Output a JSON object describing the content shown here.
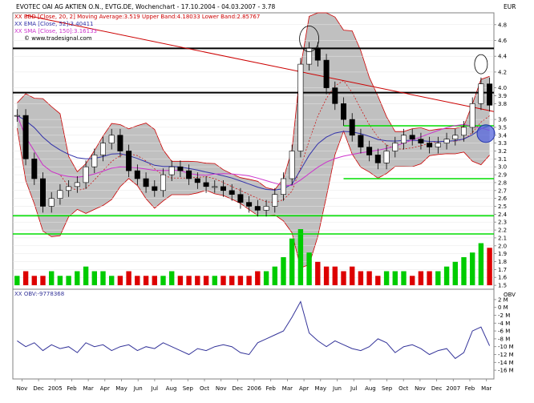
{
  "header": {
    "title_line": "EVOTEC OAI AG AKTIEN O.N., EVTG.DE, Wochenchart - 17.10.2004 - 04.03.2007 - 3.78",
    "legend": [
      {
        "text": "BBD [Close, 20, 2] Moving Average:3.519 Upper Band:4.18033 Lower Band:2.85767",
        "color": "#cc0000"
      },
      {
        "text": "EMA [Close, 52]:3.40411",
        "color": "#3333aa"
      },
      {
        "text": "SMA [Close, 150]:3.16133",
        "color": "#cc33cc"
      },
      {
        "text": "© www.tradesignal.com",
        "color": "#000000"
      }
    ],
    "currency_label": "EUR"
  },
  "indicator_label": "OBV:-9778368",
  "indicator_axis_title": "OBV",
  "colors": {
    "band_fill": "#c0c0c0",
    "band_line": "#cc0000",
    "ema": "#3333aa",
    "sma": "#cc33cc",
    "up_volume": "#00cc00",
    "down_volume": "#dd0000",
    "support_line": "#00dd00",
    "resistance_line": "#000000",
    "trend_line": "#cc0000",
    "obv_line": "#333399",
    "highlight_circle": "#5566dd"
  },
  "chart_data": [
    {
      "type": "candlestick",
      "title": "EVOTEC OAI AG AKTIEN O.N., EVTG.DE, Wochenchart - 17.10.2004 - 04.03.2007 - 3.78",
      "ylabel": "EUR",
      "ylim": [
        1.45,
        4.95
      ],
      "y_ticks": [
        1.5,
        1.6,
        1.7,
        1.8,
        1.9,
        2.0,
        2.1,
        2.2,
        2.3,
        2.4,
        2.5,
        2.6,
        2.7,
        2.8,
        2.9,
        3.0,
        3.1,
        3.2,
        3.3,
        3.4,
        3.5,
        3.6,
        3.8,
        3.9,
        4.0,
        4.2,
        4.4,
        4.6,
        4.8
      ],
      "x_tick_labels": [
        "Nov",
        "Dec",
        "2005",
        "Feb",
        "Mar",
        "Apr",
        "May",
        "Jun",
        "Jul",
        "Aug",
        "Sep",
        "Oct",
        "Nov",
        "Dec",
        "2006",
        "Feb",
        "Mar",
        "Apr",
        "May",
        "Jun",
        "Jul",
        "Aug",
        "Sep",
        "Oct",
        "Nov",
        "Dec",
        "2007",
        "Feb",
        "Mar"
      ],
      "close_series": [
        3.65,
        3.1,
        2.85,
        2.5,
        2.6,
        2.7,
        2.75,
        2.8,
        3.0,
        3.15,
        3.3,
        3.4,
        3.2,
        2.95,
        2.85,
        2.75,
        2.7,
        2.9,
        3.0,
        2.95,
        2.85,
        2.8,
        2.75,
        2.75,
        2.7,
        2.65,
        2.55,
        2.5,
        2.45,
        2.5,
        2.65,
        2.85,
        3.2,
        4.3,
        4.5,
        4.35,
        4.0,
        3.8,
        3.6,
        3.4,
        3.25,
        3.15,
        3.05,
        3.2,
        3.3,
        3.4,
        3.35,
        3.3,
        3.25,
        3.3,
        3.35,
        3.4,
        3.5,
        3.8,
        4.05,
        3.78
      ],
      "series": [
        {
          "name": "BBD Upper Band",
          "value": 4.18033
        },
        {
          "name": "BBD Moving Average",
          "value": 3.519
        },
        {
          "name": "BBD Lower Band",
          "value": 2.85767
        },
        {
          "name": "EMA [Close, 52]",
          "value": 3.40411
        },
        {
          "name": "SMA [Close, 150]",
          "value": 3.16133
        }
      ],
      "horizontal_lines": [
        {
          "kind": "resistance",
          "value": 4.5
        },
        {
          "kind": "resistance",
          "value": 3.94
        },
        {
          "kind": "support",
          "value": 3.52
        },
        {
          "kind": "support",
          "value": 2.85
        },
        {
          "kind": "support",
          "value": 2.38
        },
        {
          "kind": "support",
          "value": 2.15
        }
      ]
    },
    {
      "type": "bar",
      "title": "Volume",
      "values": [
        2,
        3,
        2,
        2,
        3,
        2,
        2,
        3,
        4,
        3,
        3,
        2,
        2,
        3,
        2,
        2,
        2,
        2,
        3,
        2,
        2,
        2,
        2,
        2,
        2,
        2,
        2,
        2,
        3,
        3,
        4,
        6,
        10,
        12,
        7,
        5,
        4,
        4,
        3,
        4,
        3,
        3,
        2,
        3,
        3,
        3,
        2,
        3,
        3,
        3,
        4,
        5,
        6,
        7,
        9,
        8
      ],
      "up": [
        true,
        false,
        false,
        false,
        true,
        true,
        true,
        true,
        true,
        true,
        true,
        true,
        false,
        false,
        false,
        false,
        false,
        true,
        true,
        false,
        false,
        false,
        false,
        true,
        false,
        false,
        false,
        false,
        false,
        true,
        true,
        true,
        true,
        true,
        true,
        false,
        false,
        false,
        false,
        false,
        false,
        false,
        false,
        true,
        true,
        true,
        false,
        false,
        false,
        true,
        true,
        true,
        true,
        true,
        true,
        false
      ]
    },
    {
      "type": "line",
      "title": "OBV:-9778368",
      "ylabel": "OBV",
      "y_ticks": [
        "2 M",
        "0 M",
        "-2 M",
        "-4 M",
        "-6 M",
        "-8 M",
        "-10 M",
        "-12 M",
        "-14 M",
        "-16 M"
      ],
      "ylim": [
        -17,
        3
      ],
      "values": [
        -8.5,
        -10.0,
        -9.0,
        -11.0,
        -9.5,
        -10.5,
        -10.0,
        -11.5,
        -9.0,
        -10.0,
        -9.5,
        -11.0,
        -10.0,
        -9.5,
        -11.0,
        -10.0,
        -10.5,
        -9.0,
        -10.0,
        -11.0,
        -12.0,
        -10.5,
        -11.0,
        -10.0,
        -9.5,
        -10.0,
        -11.5,
        -12.0,
        -9.0,
        -8.0,
        -7.0,
        -6.0,
        -2.5,
        1.5,
        -6.5,
        -8.5,
        -10.0,
        -8.5,
        -9.5,
        -10.5,
        -11.0,
        -10.0,
        -8.0,
        -9.0,
        -11.5,
        -10.0,
        -9.5,
        -10.5,
        -12.0,
        -11.0,
        -10.5,
        -13.0,
        -11.5,
        -6.0,
        -5.0,
        -9.78
      ]
    }
  ]
}
